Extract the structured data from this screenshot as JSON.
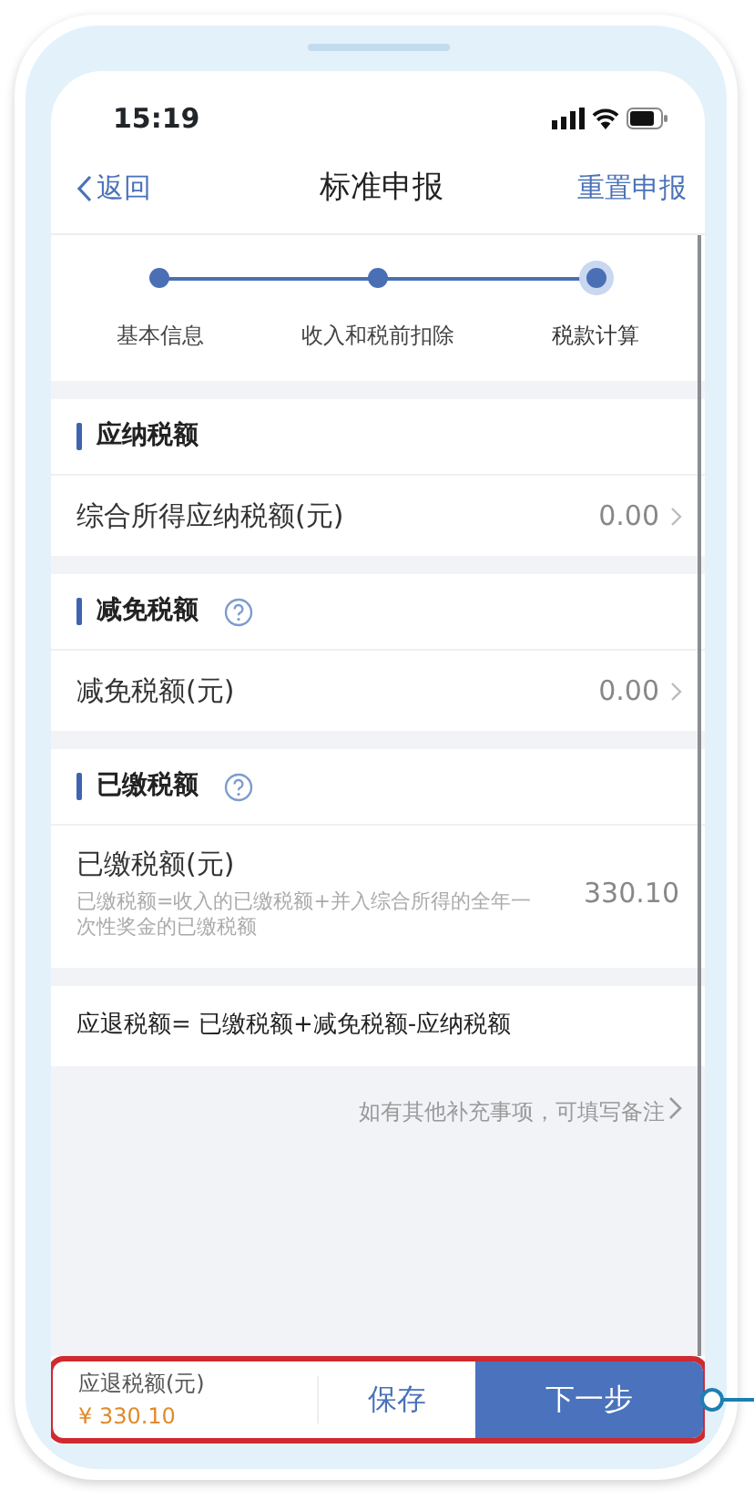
{
  "status_bar": {
    "time": "15:19"
  },
  "nav": {
    "back": "返回",
    "title": "标准申报",
    "action": "重置申报"
  },
  "steps": [
    {
      "label": "基本信息",
      "selected": false
    },
    {
      "label": "收入和税前扣除",
      "selected": false
    },
    {
      "label": "税款计算",
      "selected": true
    }
  ],
  "sections": [
    {
      "title": "应纳税额",
      "help": false,
      "rows": [
        {
          "label": "综合所得应纳税额(元)",
          "value": "0.00",
          "link": true
        }
      ]
    },
    {
      "title": "减免税额",
      "help": true,
      "rows": [
        {
          "label": "减免税额(元)",
          "value": "0.00",
          "link": true
        }
      ]
    },
    {
      "title": "已缴税额",
      "help": true,
      "rows": [
        {
          "label": "已缴税额(元)",
          "note": "已缴税额=收入的已缴税额+并入综合所得的全年一次性奖金的已缴税额",
          "value": "330.10",
          "link": false
        }
      ]
    }
  ],
  "formula": "应退税额= 已缴税额+减免税额-应纳税额",
  "remark_link": "如有其他补充事项，可填写备注",
  "footer": {
    "label": "应退税额(元)",
    "amount": "¥ 330.10",
    "save": "保存",
    "next": "下一步",
    "highlighted": true
  }
}
